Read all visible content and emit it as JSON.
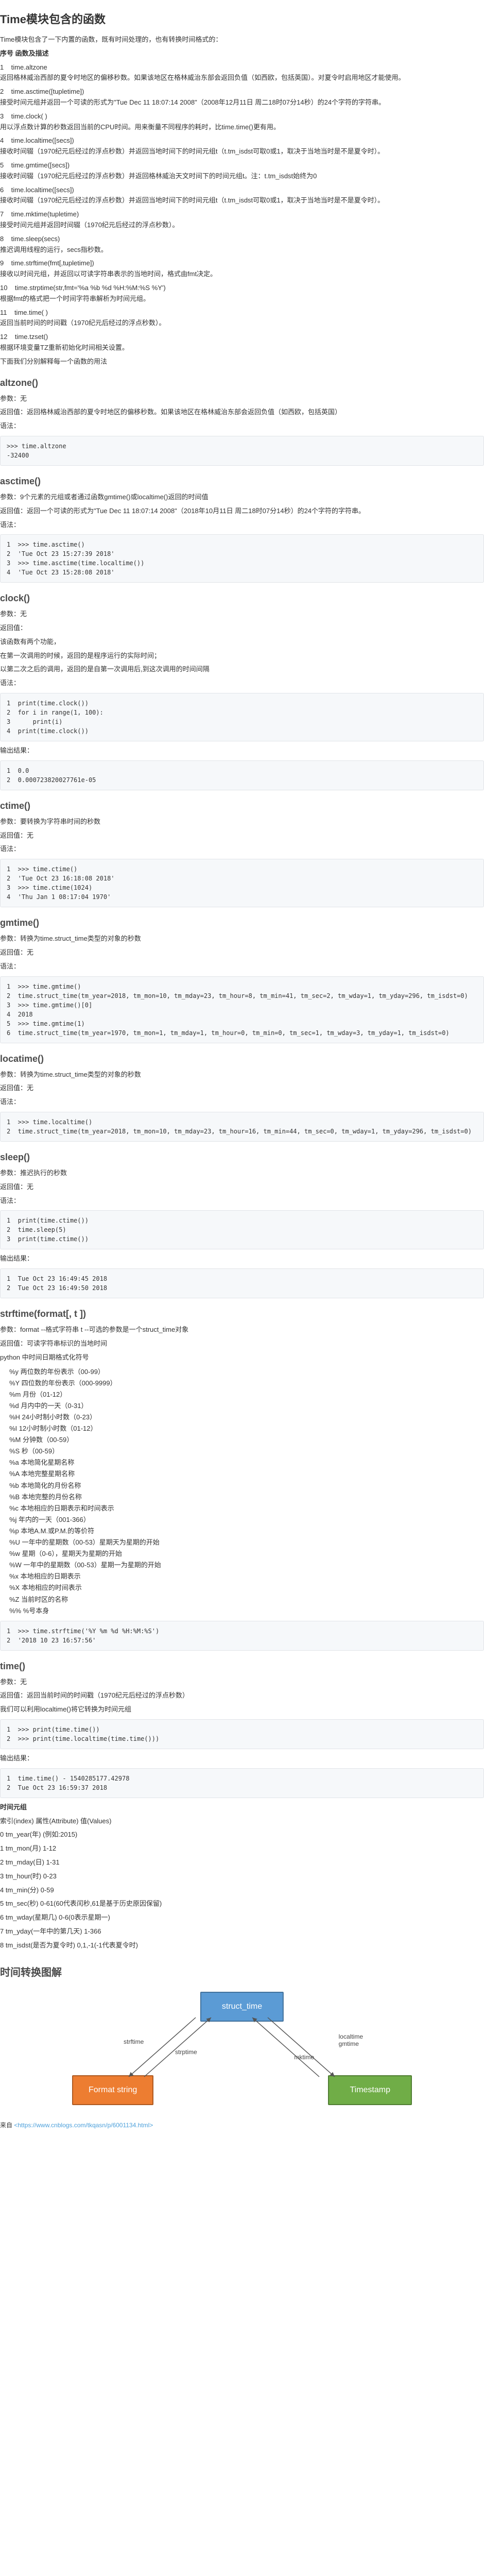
{
  "title": "Time模块包含的函数",
  "intro": "Time模块包含了一下内置的函数，既有时间处理的，也有转换时间格式的：",
  "tbl_hdr": "序号    函数及描述",
  "funcs": [
    "1    time.altzone\n返回格林威治西部的夏令时地区的偏移秒数。如果该地区在格林威治东部会返回负值（如西欧，包括英国）。对夏令时启用地区才能使用。",
    "2    time.asctime([tupletime])\n接受时间元组并返回一个可读的形式为\"Tue Dec 11 18:07:14 2008\"（2008年12月11日 周二18时07分14秒）的24个字符的字符串。",
    "3    time.clock( )\n用以浮点数计算的秒数返回当前的CPU时间。用来衡量不同程序的耗时，比time.time()更有用。",
    "4    time.localtime([secs])\n接收时间辍（1970纪元后经过的浮点秒数）并返回当地时间下的时间元组t（t.tm_isdst可取0或1，取决于当地当时是不是夏令时）。",
    "5    time.gmtime([secs])\n接收时间辍（1970纪元后经过的浮点秒数）并返回格林威治天文时间下的时间元组t。注：t.tm_isdst始终为0",
    "6    time.localtime([secs])\n接收时间辍（1970纪元后经过的浮点秒数）并返回当地时间下的时间元组t（t.tm_isdst可取0或1，取决于当地当时是不是夏令时）。",
    "7    time.mktime(tupletime)\n接受时间元组并返回时间辍（1970纪元后经过的浮点秒数）。",
    "8    time.sleep(secs)\n推迟调用线程的运行，secs指秒数。",
    "9    time.strftime(fmt[,tupletime])\n接收以时间元组，并返回以可读字符串表示的当地时间，格式由fmt决定。",
    "10    time.strptime(str,fmt='%a %b %d %H:%M:%S %Y')\n根据fmt的格式把一个时间字符串解析为时间元组。",
    "11    time.time( )\n返回当前时间的时间戳（1970纪元后经过的浮点秒数）。",
    "12    time.tzset()\n根据环境变量TZ重新初始化时间相关设置。"
  ],
  "sub_intro": "下面我们分别解释每一个函数的用法",
  "altzone": {
    "h": "altzone()",
    "p1": "参数：无",
    "p2": "返回值：返回格林威治西部的夏令时地区的偏移秒数。如果该地区在格林威治东部会返回负值（如西欧，包括英国）",
    "p3": "语法：",
    "code": ">>> time.altzone\n-32400"
  },
  "asctime": {
    "h": "asctime()",
    "p1": "参数：9个元素的元组或者通过函数gmtime()或localtime()返回的时间值",
    "p2": "返回值：返回一个可读的形式为\"Tue Dec 11 18:07:14 2008\"（2018年10月11日 周二18时07分14秒）的24个字符的字符串。",
    "p3": "语法：",
    "code": "1  >>> time.asctime()\n2  'Tue Oct 23 15:27:39 2018'\n3  >>> time.asctime(time.localtime())\n4  'Tue Oct 23 15:28:08 2018'"
  },
  "clock": {
    "h": "clock()",
    "p1": "参数：无",
    "p2": "返回值：",
    "p3": "该函数有两个功能，",
    "p4": "在第一次调用的时候，返回的是程序运行的实际时间；",
    "p5": "以第二次之后的调用，返回的是自第一次调用后,到这次调用的时间间隔",
    "p6": "语法：",
    "code": "1  print(time.clock())\n2  for i in range(1, 100):\n3      print(i)\n4  print(time.clock())",
    "out_h": "输出结果：",
    "out": "1  0.0\n2  0.000723820027761e-05"
  },
  "ctime": {
    "h": "ctime()",
    "p1": "参数：要转换为字符串时间的秒数",
    "p2": "返回值：无",
    "p3": "语法：",
    "code": "1  >>> time.ctime()\n2  'Tue Oct 23 16:18:08 2018'\n3  >>> time.ctime(1024)\n4  'Thu Jan 1 08:17:04 1970'"
  },
  "gmtime": {
    "h": "gmtime()",
    "p1": "参数：转换为time.struct_time类型的对象的秒数",
    "p2": "返回值：无",
    "p3": "语法：",
    "code": "1  >>> time.gmtime()\n2  time.struct_time(tm_year=2018, tm_mon=10, tm_mday=23, tm_hour=8, tm_min=41, tm_sec=2, tm_wday=1, tm_yday=296, tm_isdst=0)\n3  >>> time.gmtime()[0]\n4  2018\n5  >>> time.gmtime(1)\n6  time.struct_time(tm_year=1970, tm_mon=1, tm_mday=1, tm_hour=0, tm_min=0, tm_sec=1, tm_wday=3, tm_yday=1, tm_isdst=0)"
  },
  "locatime": {
    "h": "locatime()",
    "p1": "参数：转换为time.struct_time类型的对象的秒数",
    "p2": "返回值：无",
    "p3": "语法：",
    "code": "1  >>> time.localtime()\n2  time.struct_time(tm_year=2018, tm_mon=10, tm_mday=23, tm_hour=16, tm_min=44, tm_sec=0, tm_wday=1, tm_yday=296, tm_isdst=0)"
  },
  "sleep": {
    "h": "sleep()",
    "p1": "参数：推迟执行的秒数",
    "p2": "返回值：无",
    "p3": "语法：",
    "code": "1  print(time.ctime())\n2  time.sleep(5)\n3  print(time.ctime())",
    "out_h": "输出结果：",
    "out": "1  Tue Oct 23 16:49:45 2018\n2  Tue Oct 23 16:49:50 2018"
  },
  "strftime": {
    "h": "strftime(format[, t ])",
    "p1": "参数：format --格式字符串 t --可选的参数是一个struct_time对象",
    "p2": "返回值：可读字符串标识的当地时间",
    "fmt_h": "python 中时间日期格式化符号",
    "fmts": [
      "%y 两位数的年份表示（00-99）",
      "%Y 四位数的年份表示（000-9999）",
      "%m 月份（01-12）",
      "%d 月内中的一天（0-31）",
      "%H 24小时制小时数（0-23）",
      "%I 12小时制小时数（01-12）",
      "%M 分钟数（00-59）",
      "%S 秒（00-59）",
      "%a 本地简化星期名称",
      "%A 本地完整星期名称",
      "%b 本地简化的月份名称",
      "%B 本地完整的月份名称",
      "%c 本地相应的日期表示和时间表示",
      "%j 年内的一天（001-366）",
      "%p 本地A.M.或P.M.的等价符",
      "%U 一年中的星期数（00-53）星期天为星期的开始",
      "%w 星期（0-6），星期天为星期的开始",
      "%W 一年中的星期数（00-53）星期一为星期的开始",
      "%x 本地相应的日期表示",
      "%X 本地相应的时间表示",
      "%Z 当前时区的名称",
      "%% %号本身"
    ],
    "code": "1  >>> time.strftime('%Y %m %d %H:%M:%S')\n2  '2018 10 23 16:57:56'"
  },
  "time": {
    "h": "time()",
    "p1": "参数：无",
    "p2": "返回值：返回当前时间的时间戳（1970纪元后经过的浮点秒数）",
    "nxt": "我们可以利用localtime()将它转换为时间元组",
    "code": "1  >>> print(time.time())\n2  >>> print(time.localtime(time.time()))",
    "res_h": "输出结果：",
    "res": "1  time.time() - 1540285177.42978\n2  Tue Oct 23 16:59:37 2018",
    "attr_h": "时间元组",
    "attr_hdr": "索引(index)  属性(Attribute)  值(Values)",
    "attrs": [
      "0  tm_year(年)  (例如:2015)",
      "1  tm_mon(月)  1-12",
      "2  tm_mday(日)  1-31",
      "3  tm_hour(时)  0-23",
      "4  tm_min(分)  0-59",
      "5  tm_sec(秒)  0-61(60代表闰秒,61是基于历史原因保留)",
      "6  tm_wday(星期几)  0-6(0表示星期一)",
      "7  tm_yday(一年中的第几天)  1-366",
      "8  tm_isdst(是否为夏令时)  0,1,-1(-1代表夏令时)"
    ]
  },
  "diagram_h": "时间转换图解",
  "d1": "struct_time",
  "d2": "Format string",
  "d3": "Timestamp",
  "lbl1": "strftime",
  "lbl2": "strptime",
  "lbl3": "localtime\ngmtime",
  "lbl4": "mktime",
  "src_pre": "来自",
  "src": "<https://www.cnblogs.com/tkqasn/p/6001134.html>"
}
